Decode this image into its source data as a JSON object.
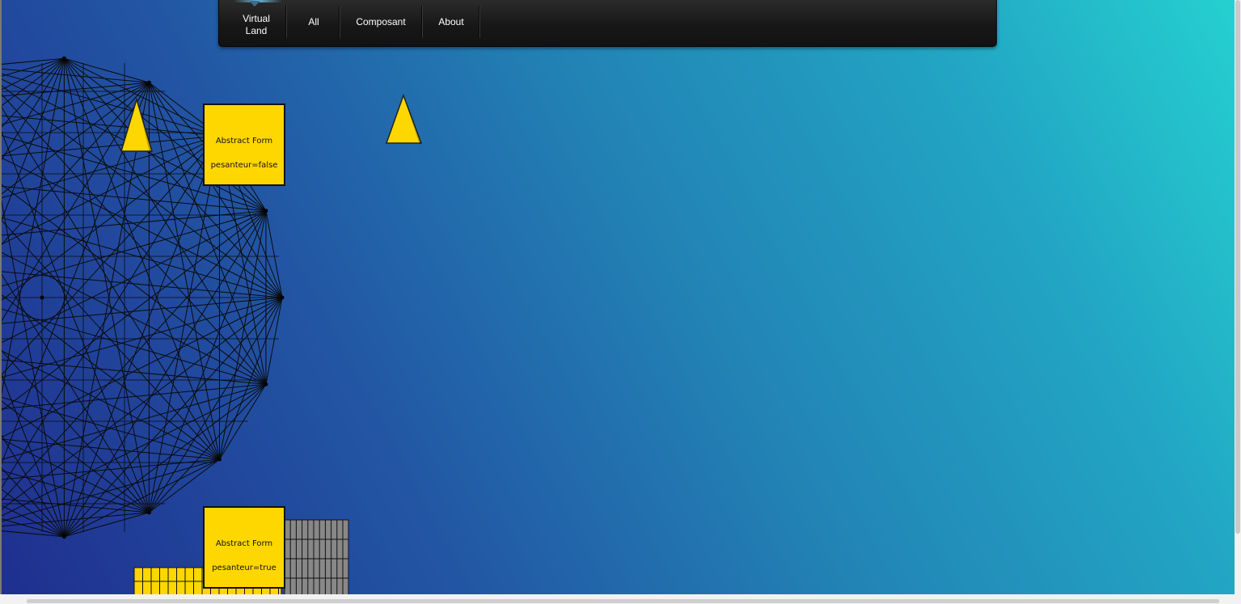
{
  "navigation": {
    "items": [
      {
        "label_line1": "Virtual",
        "label_line2": "Land"
      },
      {
        "label": "All"
      },
      {
        "label": "Composant"
      },
      {
        "label": "About"
      }
    ]
  },
  "forms": [
    {
      "title": "Abstract Form",
      "property": "pesanteur=false"
    },
    {
      "title": "Abstract Form",
      "property": "pesanteur=true"
    }
  ],
  "colors": {
    "form_fill": "#ffd700",
    "triangle_fill": "#ffd700",
    "mesh_stroke": "#0a0a0a",
    "grey_block": "#888888",
    "navbar": "#1c1c1c"
  },
  "shapes": {
    "mesh_vertices": 17,
    "triangle_count": 2,
    "grey_block_count": 1,
    "yellow_block_count": 1
  }
}
